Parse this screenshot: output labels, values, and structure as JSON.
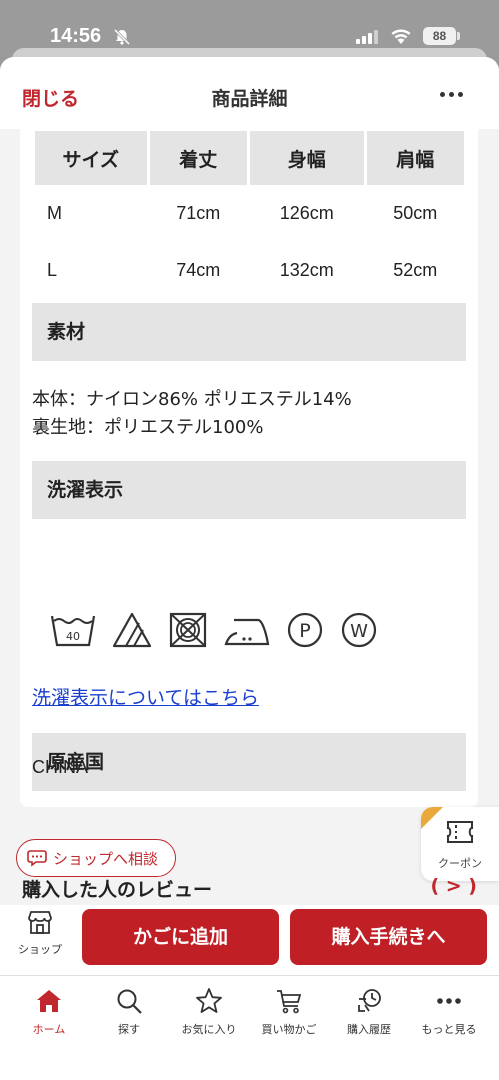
{
  "status": {
    "time": "14:56",
    "battery": "88"
  },
  "header": {
    "close": "閉じる",
    "title": "商品詳細"
  },
  "size_table": {
    "headers": [
      "サイズ",
      "着丈",
      "身幅",
      "肩幅"
    ],
    "rows": [
      [
        "M",
        "71cm",
        "126cm",
        "50cm"
      ],
      [
        "L",
        "74cm",
        "132cm",
        "52cm"
      ]
    ]
  },
  "material": {
    "heading": "素材",
    "lines": [
      "本体：ナイロン86% ポリエステル14%",
      "裏生地：ポリエステル100%"
    ]
  },
  "laundry": {
    "heading": "洗濯表示",
    "wash_temp": "40",
    "icons": [
      "wash-40-icon",
      "bleach-not-allowed-icon",
      "tumble-dry-prohibited-icon",
      "iron-low-icon",
      "dry-clean-p-icon",
      "wet-clean-w-icon"
    ],
    "link": "洗濯表示についてはこちら"
  },
  "origin": {
    "heading": "原産国",
    "value": "CHINA"
  },
  "consult": {
    "label": "ショップへ相談"
  },
  "reviews": {
    "title": "購入した人のレビュー",
    "arrow": "( > )"
  },
  "coupon": {
    "label": "クーポン"
  },
  "actions": {
    "shop": "ショップ",
    "add_to_cart": "かごに追加",
    "checkout": "購入手続きへ"
  },
  "tabs": [
    {
      "label": "ホーム",
      "icon": "home-icon"
    },
    {
      "label": "探す",
      "icon": "search-icon"
    },
    {
      "label": "お気に入り",
      "icon": "star-icon"
    },
    {
      "label": "買い物かご",
      "icon": "cart-icon"
    },
    {
      "label": "購入履歴",
      "icon": "history-icon"
    },
    {
      "label": "もっと見る",
      "icon": "more-icon"
    }
  ],
  "colors": {
    "accent": "#c0282d",
    "button": "#bf1f25",
    "link": "#1a3fcf",
    "section_bg": "#e4e4e4",
    "coupon_corner": "#e9a93b"
  }
}
